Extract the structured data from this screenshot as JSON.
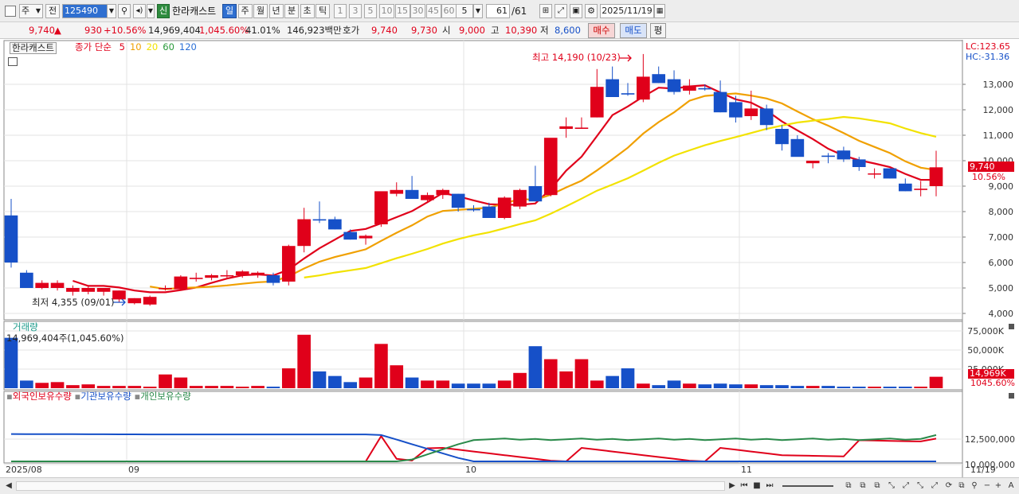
{
  "toolbar": {
    "period_select": "주",
    "prev_label": "전",
    "code": "125490",
    "credit_badge": "신",
    "stock_name": "한라캐스트",
    "period_tabs": [
      "일",
      "주",
      "월",
      "년",
      "분",
      "초",
      "틱"
    ],
    "active_period": "일",
    "minute_tabs": [
      "1",
      "3",
      "5",
      "10",
      "15",
      "30",
      "45",
      "60"
    ],
    "count_select": "5",
    "count_display": "61",
    "count_total": "/61",
    "date": "2025/11/19"
  },
  "quote": {
    "price": "9,740",
    "change_arrow": "▲",
    "change": "930",
    "change_pct": "+10.56%",
    "volume": "14,969,404",
    "volume_ratio": "1,045.60%",
    "turnover": "41.01%",
    "amount": "146,923백만",
    "bid_label": "호가",
    "ask_price": "9,740",
    "bid_price": "9,730",
    "open_label": "시",
    "open": "9,000",
    "high_label": "고",
    "high": "10,390",
    "low_label": "저",
    "low": "8,600",
    "buy_button": "매수",
    "sell_button": "매도",
    "avg_button": "평"
  },
  "price_panel": {
    "stock_label": "한라캐스트",
    "ma_title": "종가 단순",
    "ma_periods": [
      "5",
      "10",
      "20",
      "60",
      "120"
    ],
    "ma_colors": [
      "#e0001a",
      "#f0a000",
      "#f2e200",
      "#2a9a3a",
      "#2a6fd6"
    ],
    "lc_label": "LC:123.65",
    "hc_label": "HC:-31.36",
    "high_annotation": "최고 14,190 (10/23)",
    "low_annotation": "최저 4,355 (09/01)",
    "current_price_tag": "9,740",
    "current_pct_tag": "10.56%",
    "y_ticks": [
      "13,000",
      "12,000",
      "11,000",
      "10,000",
      "9,000",
      "8,000",
      "7,000",
      "6,000",
      "5,000",
      "4,000"
    ]
  },
  "volume_panel": {
    "title": "거래량",
    "value_label": "14,969,404주(1,045.60%)",
    "y_ticks": [
      "75,000K",
      "50,000K",
      "25,000K"
    ],
    "current_tag": "14,969K",
    "current_pct_tag": "1045.60%"
  },
  "holding_panel": {
    "series": [
      "외국인보유수량",
      "기관보유수량",
      "개인보유수량"
    ],
    "y_ticks": [
      "12,500,000",
      "10,000,000"
    ]
  },
  "x_axis": {
    "labels": [
      "2025/08",
      "09",
      "10",
      "11"
    ],
    "last_date": "11/19"
  },
  "chart_data": {
    "type": "candlestick",
    "candles": [
      [
        7850,
        8500,
        5800,
        6000
      ],
      [
        5600,
        5700,
        5000,
        5000
      ],
      [
        5000,
        5300,
        4950,
        5200
      ],
      [
        5000,
        5300,
        4900,
        5200
      ],
      [
        4850,
        5100,
        4700,
        5000
      ],
      [
        4850,
        5100,
        4750,
        5000
      ],
      [
        4850,
        5000,
        4700,
        5000
      ],
      [
        4550,
        4900,
        4450,
        4900
      ],
      [
        4400,
        4600,
        4355,
        4600
      ],
      [
        4350,
        4700,
        4300,
        4650
      ],
      [
        4950,
        5100,
        4900,
        5000
      ],
      [
        4950,
        5500,
        4900,
        5450
      ],
      [
        5350,
        5600,
        5250,
        5400
      ],
      [
        5400,
        5550,
        5300,
        5500
      ],
      [
        5500,
        5700,
        5400,
        5500
      ],
      [
        5500,
        5700,
        5400,
        5650
      ],
      [
        5500,
        5650,
        5400,
        5600
      ],
      [
        5500,
        5600,
        5100,
        5200
      ],
      [
        5250,
        6700,
        5100,
        6650
      ],
      [
        6650,
        8150,
        6400,
        7700
      ],
      [
        7700,
        8400,
        7550,
        7650
      ],
      [
        7700,
        7800,
        7300,
        7300
      ],
      [
        7200,
        7300,
        6900,
        6900
      ],
      [
        6950,
        7100,
        6700,
        7050
      ],
      [
        7500,
        8750,
        7400,
        8800
      ],
      [
        8700,
        9150,
        8600,
        8850
      ],
      [
        8850,
        9400,
        8500,
        8500
      ],
      [
        8450,
        8750,
        8400,
        8650
      ],
      [
        8650,
        8900,
        8500,
        8850
      ],
      [
        8700,
        8700,
        8000,
        8150
      ],
      [
        8100,
        8250,
        8000,
        8050
      ],
      [
        8200,
        8350,
        7800,
        7750
      ],
      [
        7750,
        8600,
        7700,
        8550
      ],
      [
        8200,
        8900,
        8100,
        8850
      ],
      [
        9000,
        9800,
        8400,
        8400
      ],
      [
        8650,
        10850,
        8600,
        10900
      ],
      [
        11250,
        11700,
        10900,
        11350
      ],
      [
        11250,
        11700,
        11250,
        11300
      ],
      [
        11700,
        13600,
        11700,
        12900
      ],
      [
        13200,
        13700,
        12500,
        12500
      ],
      [
        12650,
        13050,
        12550,
        12600
      ],
      [
        12400,
        14190,
        12300,
        13300
      ],
      [
        13400,
        13700,
        13050,
        13050
      ],
      [
        13200,
        13550,
        12600,
        12700
      ],
      [
        12750,
        13200,
        12600,
        12950
      ],
      [
        12850,
        13000,
        12750,
        12800
      ],
      [
        12700,
        13150,
        11900,
        11900
      ],
      [
        12300,
        12550,
        11500,
        11700
      ],
      [
        11750,
        12750,
        11600,
        12050
      ],
      [
        12050,
        12200,
        11200,
        11400
      ],
      [
        11250,
        11400,
        10400,
        10650
      ],
      [
        10850,
        11000,
        10200,
        10150
      ],
      [
        9900,
        10000,
        9700,
        10000
      ],
      [
        10200,
        10300,
        9900,
        10150
      ],
      [
        10400,
        10550,
        9950,
        10050
      ],
      [
        10050,
        10150,
        9600,
        9750
      ],
      [
        9500,
        9700,
        9300,
        9500
      ],
      [
        9700,
        9700,
        9300,
        9300
      ],
      [
        9100,
        9300,
        8800,
        8800
      ],
      [
        8850,
        9200,
        8600,
        8900
      ],
      [
        9000,
        10390,
        8600,
        9740
      ]
    ],
    "volume": [
      66000,
      10000,
      7000,
      8000,
      4000,
      5000,
      3000,
      3000,
      3000,
      2000,
      18000,
      14000,
      3000,
      3000,
      3000,
      2000,
      3000,
      2000,
      26000,
      70000,
      22000,
      16000,
      8000,
      14000,
      58000,
      30000,
      14000,
      10000,
      10000,
      6000,
      6000,
      6000,
      10000,
      20000,
      55000,
      38000,
      22000,
      38000,
      10000,
      16000,
      26000,
      6000,
      4000,
      10000,
      6000,
      5000,
      6000,
      5000,
      5000,
      4000,
      4000,
      3000,
      3000,
      3000,
      2000,
      2000,
      2000,
      2000,
      2000,
      2000,
      14969
    ]
  }
}
